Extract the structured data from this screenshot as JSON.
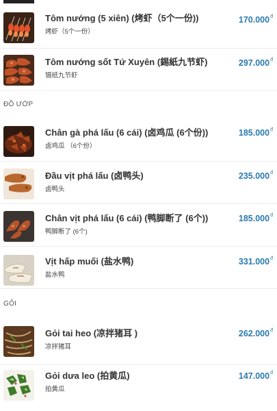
{
  "currency_symbol": "đ",
  "sections": [
    {
      "title": ""
    },
    {
      "title": "ĐỒ ƯỚP"
    },
    {
      "title": "GỎI"
    }
  ],
  "items": [
    {
      "name": "Tôm nướng (5 xiên) (烤虾（5个一份))",
      "sub": "烤虾（5个一份）",
      "price": "170.000",
      "icon": "grilled-shrimp-skewers"
    },
    {
      "name": "Tôm nướng sốt Tứ Xuyên (錫紙九节虾)",
      "sub": "锡纸九节虾",
      "price": "297.000",
      "icon": "sichuan-shrimp"
    },
    {
      "name": "Chân gà phá lấu (6 cái) (卤鸡瓜  (6个份))",
      "sub": "卤鸡瓜 （6个份）",
      "price": "185.000",
      "icon": "braised-chicken-feet"
    },
    {
      "name": "Đầu vịt phá lấu (卤鸭头)",
      "sub": "卤鸭头",
      "price": "235.000",
      "icon": "braised-duck-head"
    },
    {
      "name": "Chân vịt phá lấu (6 cái) (鸭脚断了 (6个))",
      "sub": "鸭脚断了 (6个)",
      "price": "185.000",
      "icon": "braised-duck-feet"
    },
    {
      "name": "Vịt hấp muối (盐水鸭)",
      "sub": "盐水鸭",
      "price": "331.000",
      "icon": "salted-duck"
    },
    {
      "name": "Gỏi tai heo (凉拌猪耳 )",
      "sub": "凉拌猪耳",
      "price": "262.000",
      "icon": "pig-ear-salad"
    },
    {
      "name": "Gỏi dưa leo (拍黄瓜)",
      "sub": "拍黄瓜",
      "price": "147.000",
      "icon": "cucumber-salad"
    }
  ]
}
